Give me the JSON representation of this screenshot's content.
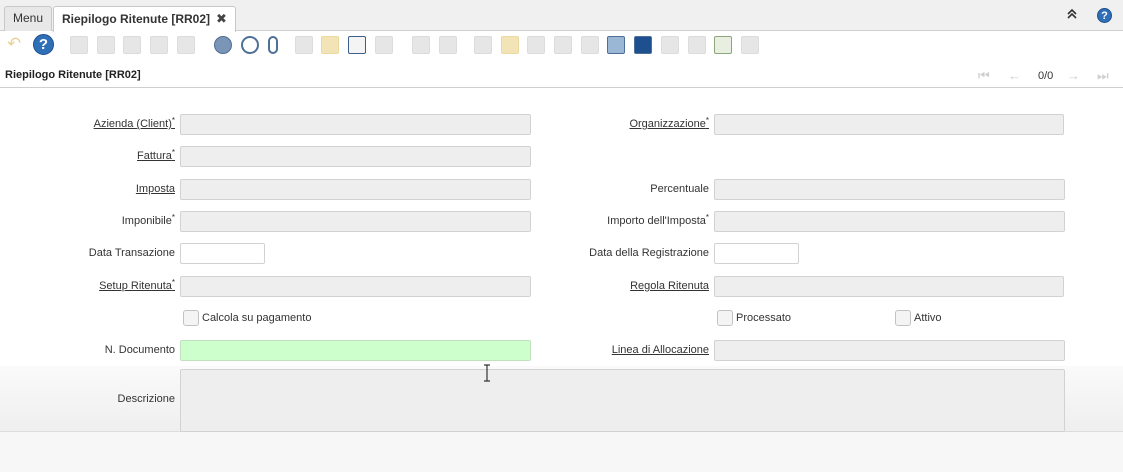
{
  "tabs": {
    "menu_label": "Menu",
    "active_label": "Riepilogo Ritenute [RR02]",
    "close_glyph": "✖",
    "collapse_glyph": "⌃",
    "help_glyph": "?"
  },
  "toolbar": {
    "help_glyph": "?",
    "undo_glyph": "↶"
  },
  "header": {
    "title": "Riepilogo Ritenute [RR02]",
    "record_count": "0/0"
  },
  "form": {
    "azienda_label": "Azienda (Client)",
    "organizzazione_label": "Organizzazione",
    "fattura_label": "Fattura",
    "imposta_label": "Imposta",
    "percentuale_label": "Percentuale",
    "imponibile_label": "Imponibile",
    "importo_imposta_label": "Importo dell'Imposta",
    "data_transazione_label": "Data Transazione",
    "data_registrazione_label": "Data della Registrazione",
    "setup_ritenuta_label": "Setup Ritenuta",
    "regola_ritenuta_label": "Regola Ritenuta",
    "calcola_label": "Calcola su pagamento",
    "processato_label": "Processato",
    "attivo_label": "Attivo",
    "n_documento_label": "N. Documento",
    "linea_allocazione_label": "Linea di Allocazione",
    "descrizione_label": "Descrizione",
    "required_marker": "*",
    "azienda_value": "",
    "organizzazione_value": "",
    "fattura_value": "",
    "imposta_value": "",
    "percentuale_value": "",
    "imponibile_value": "",
    "importo_imposta_value": "",
    "data_transazione_value": "",
    "data_registrazione_value": "",
    "setup_ritenuta_value": "",
    "regola_ritenuta_value": "",
    "n_documento_value": "",
    "linea_allocazione_value": "",
    "descrizione_value": ""
  },
  "colors": {
    "required_field_green": "#ccffcc",
    "readonly_field": "#eeeeee",
    "help_blue": "#2f6fb8"
  }
}
